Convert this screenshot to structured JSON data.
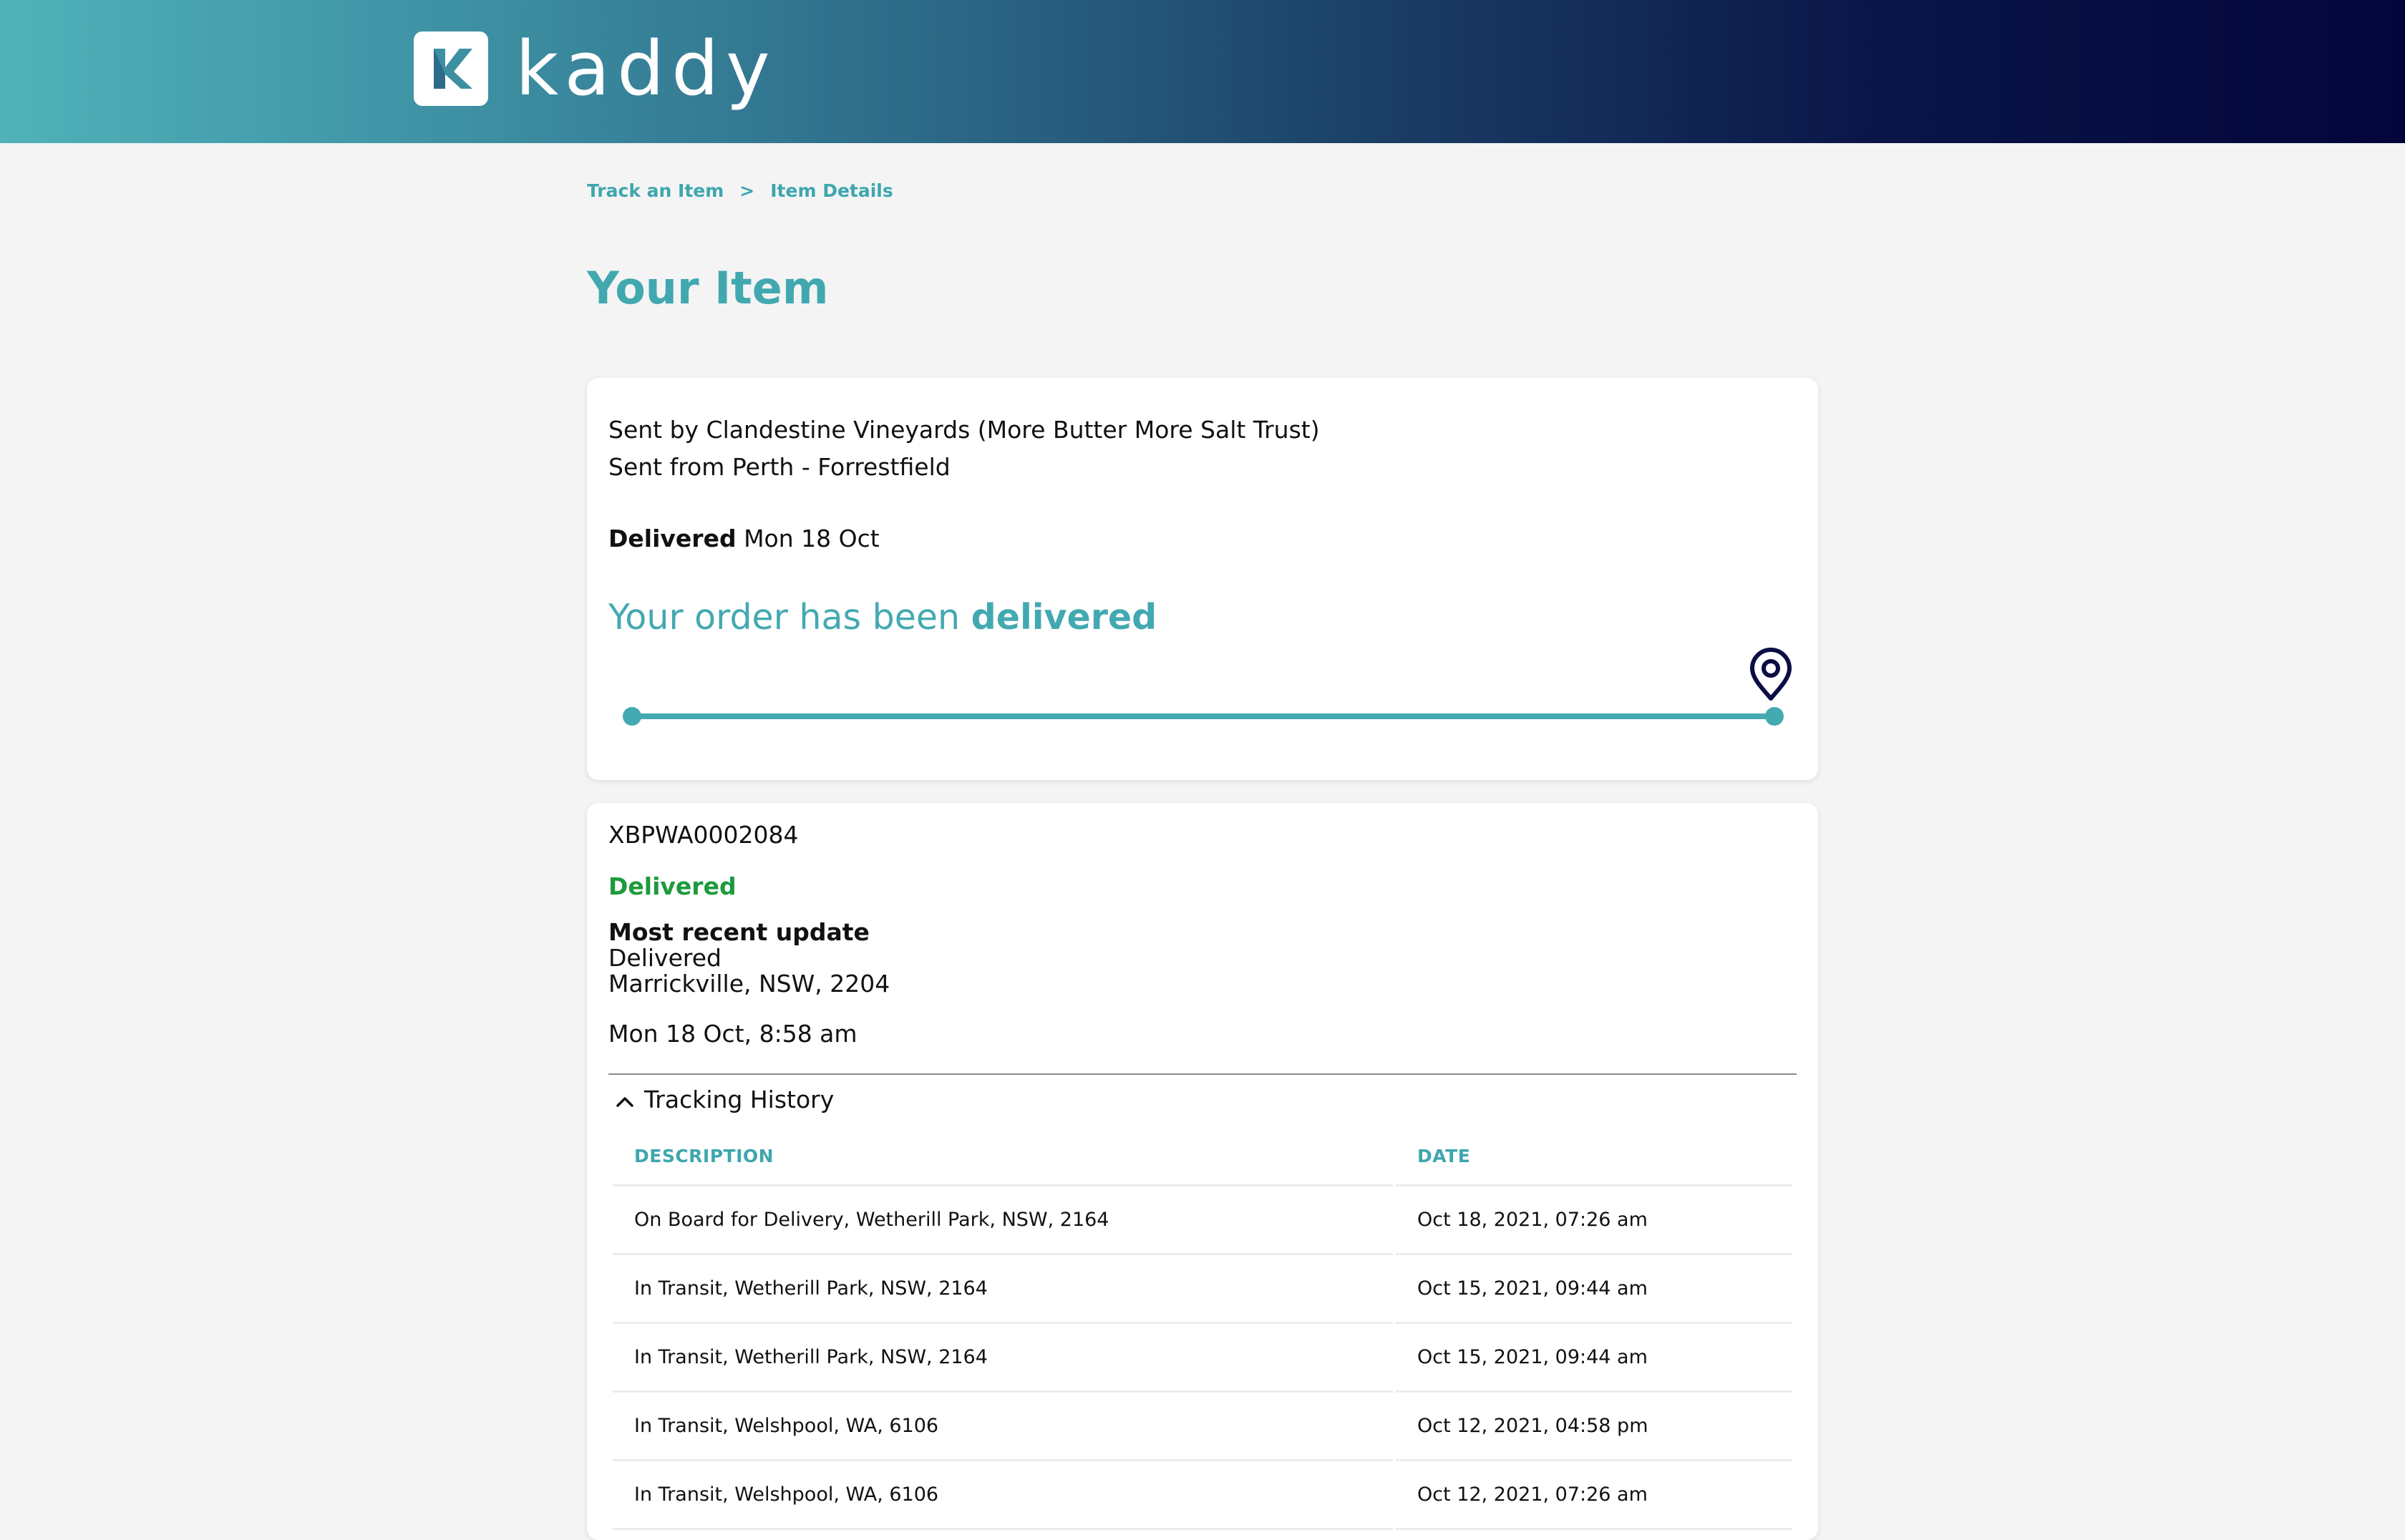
{
  "brand": {
    "name": "kaddy"
  },
  "breadcrumb": {
    "items": [
      "Track an Item",
      "Item Details"
    ],
    "separator": ">"
  },
  "page": {
    "title": "Your Item"
  },
  "summary": {
    "sent_by": "Sent by Clandestine Vineyards (More Butter More Salt Trust)",
    "sent_from": "Sent from Perth - Forrestfield",
    "delivered_label": "Delivered",
    "delivered_date": "Mon 18 Oct",
    "status_prefix": "Your order has been",
    "status_word": "delivered",
    "progress_fraction": 1.0
  },
  "item": {
    "tracking_number": "XBPWA0002084",
    "status": "Delivered",
    "recent_update_label": "Most recent update",
    "recent_update_status": "Delivered",
    "recent_update_location": "Marrickville, NSW, 2204",
    "recent_update_time": "Mon 18 Oct, 8:58 am"
  },
  "history": {
    "toggle_label": "Tracking History",
    "columns": [
      "DESCRIPTION",
      "DATE"
    ],
    "rows": [
      {
        "description": "On Board for Delivery, Wetherill Park, NSW, 2164",
        "date": "Oct 18, 2021, 07:26 am"
      },
      {
        "description": "In Transit, Wetherill Park, NSW, 2164",
        "date": "Oct 15, 2021, 09:44 am"
      },
      {
        "description": "In Transit, Wetherill Park, NSW, 2164",
        "date": "Oct 15, 2021, 09:44 am"
      },
      {
        "description": "In Transit, Welshpool, WA, 6106",
        "date": "Oct 12, 2021, 04:58 pm"
      },
      {
        "description": "In Transit, Welshpool, WA, 6106",
        "date": "Oct 12, 2021, 07:26 am"
      }
    ]
  },
  "colors": {
    "accent": "#43a9b1",
    "delivered_green": "#1d9a3c",
    "pin": "#0b0d45",
    "header_start": "#4fb2b9",
    "header_end": "#03053a"
  },
  "icons": [
    "kaddy-logo-icon",
    "chevron-right-icon",
    "map-pin-icon",
    "chevron-up-icon"
  ]
}
